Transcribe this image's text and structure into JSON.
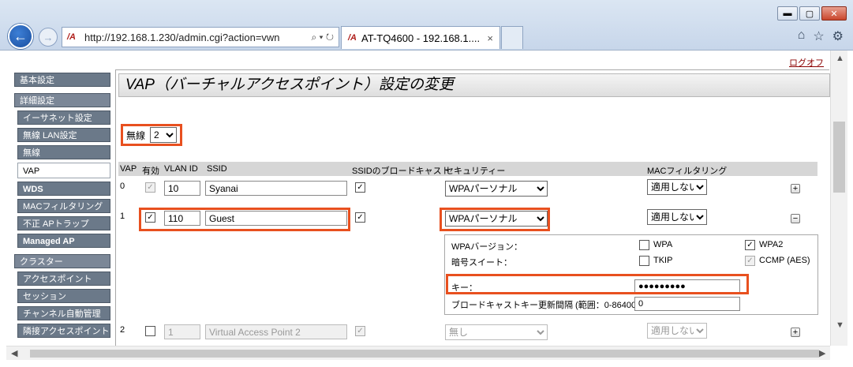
{
  "window": {
    "minimize": "▬",
    "maximize": "▢",
    "close": "✕"
  },
  "browser": {
    "url": "http://192.168.1.230/admin.cgi?action=vwn",
    "tab_title": "AT-TQ4600 - 192.168.1....",
    "tab_close": "×",
    "addr_tools": "⌕ ▾ ↻",
    "logo_text": "/A"
  },
  "page": {
    "logoff": "ログオフ",
    "title": "VAP（バーチャルアクセスポイント）設定の変更"
  },
  "sidebar": [
    {
      "label": "基本設定"
    },
    {
      "label": "詳細設定"
    },
    {
      "label": "イーサネット設定"
    },
    {
      "label": "無線 LAN設定"
    },
    {
      "label": "無線"
    },
    {
      "label": "VAP"
    },
    {
      "label": "WDS"
    },
    {
      "label": "MACフィルタリング"
    },
    {
      "label": "不正 APトラップ"
    },
    {
      "label": "Managed AP"
    },
    {
      "label": "クラスター"
    },
    {
      "label": "アクセスポイント"
    },
    {
      "label": "セッション"
    },
    {
      "label": "チャンネル自動管理"
    },
    {
      "label": "隣接アクセスポイント"
    }
  ],
  "radio": {
    "label": "無線",
    "value": "2"
  },
  "table": {
    "headers": {
      "vap": "VAP",
      "enabled": "有効",
      "vlan": "VLAN ID",
      "ssid": "SSID",
      "broadcast": "SSIDのブロードキャスト",
      "security": "セキュリティー",
      "mac": "MACフィルタリング"
    },
    "rows": [
      {
        "vap": "0",
        "vlan": "10",
        "ssid": "Syanai",
        "security": "WPAパーソナル",
        "mac": "適用しない",
        "toggle": "+"
      },
      {
        "vap": "1",
        "vlan": "110",
        "ssid": "Guest",
        "security": "WPAパーソナル",
        "mac": "適用しない",
        "toggle": "−"
      },
      {
        "vap": "2",
        "vlan": "1",
        "ssid": "Virtual Access Point 2",
        "security": "無し",
        "mac": "適用しない",
        "toggle": "+"
      }
    ]
  },
  "wpa": {
    "version_label": "WPAバージョン：",
    "wpa": "WPA",
    "wpa2": "WPA2",
    "suite_label": "暗号スイート：",
    "tkip": "TKIP",
    "ccmp": "CCMP (AES)",
    "key_label": "キー：",
    "key_value": "●●●●●●●●●",
    "interval_label": "ブロードキャストキー更新間隔 (範囲：0-86400)",
    "interval_value": "0"
  }
}
